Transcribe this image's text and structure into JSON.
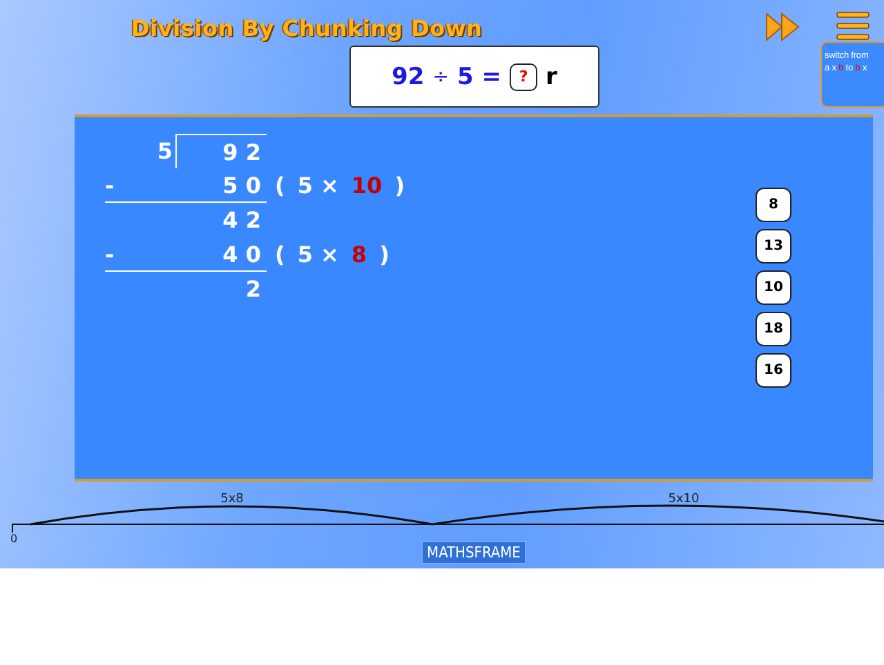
{
  "title": "Division By Chunking Down",
  "equation": {
    "dividend": "92",
    "operator": "÷",
    "divisor": "5",
    "equals": "=",
    "answer_placeholder": "?",
    "remainder_label": "r"
  },
  "switch_note": {
    "line_1": "switch from",
    "line_2": [
      {
        "text": "a x ",
        "highlight": false
      },
      {
        "text": "b",
        "highlight": true
      },
      {
        "text": " to ",
        "highlight": false
      },
      {
        "text": "b",
        "highlight": true
      },
      {
        "text": " x",
        "highlight": false
      }
    ]
  },
  "division": {
    "divisor": "5",
    "dividend": "9 2",
    "steps": [
      {
        "sign": "-",
        "amount": "5 0",
        "open": "(",
        "factor": "5 ×",
        "multiplier": "10",
        "close": ")",
        "remainder": "4 2"
      },
      {
        "sign": "-",
        "amount": "4 0",
        "open": "(",
        "factor": "5 ×",
        "multiplier": "8",
        "close": ")",
        "remainder": "2"
      }
    ]
  },
  "answer_options": [
    "8",
    "13",
    "10",
    "18",
    "16"
  ],
  "number_line": {
    "start": "0",
    "jumps": [
      {
        "label": "5x8"
      },
      {
        "label": "5x10"
      }
    ]
  },
  "logo": "MATHSFRAME"
}
